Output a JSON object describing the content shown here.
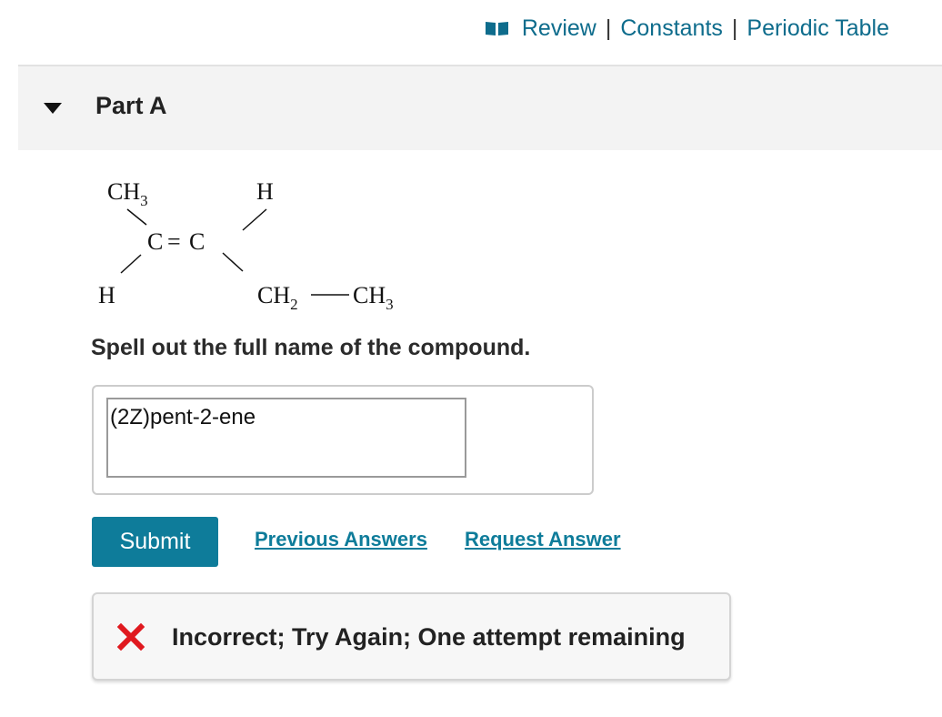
{
  "topbar": {
    "links": [
      "Review",
      "Constants",
      "Periodic Table"
    ],
    "separator": "|"
  },
  "part": {
    "title": "Part A",
    "structure": {
      "top_left": "CH",
      "top_left_sub": "3",
      "top_right": "H",
      "left_carbon": "C",
      "double_bond": "=",
      "right_carbon": "C",
      "bottom_left": "H",
      "bottom_right_a": "CH",
      "bottom_right_a_sub": "2",
      "bond": "—",
      "bottom_right_b": "CH",
      "bottom_right_b_sub": "3"
    },
    "question": "Spell out the full name of the compound.",
    "answer_value": "(2Z)pent-2-ene"
  },
  "actions": {
    "submit_label": "Submit",
    "previous_answers": "Previous Answers",
    "request_answer": "Request Answer"
  },
  "feedback": {
    "message": "Incorrect; Try Again; One attempt remaining",
    "icon": "x-icon",
    "icon_color": "#e0191f"
  },
  "colors": {
    "accent": "#0e7c9a",
    "link_top": "#0e6c8c"
  }
}
